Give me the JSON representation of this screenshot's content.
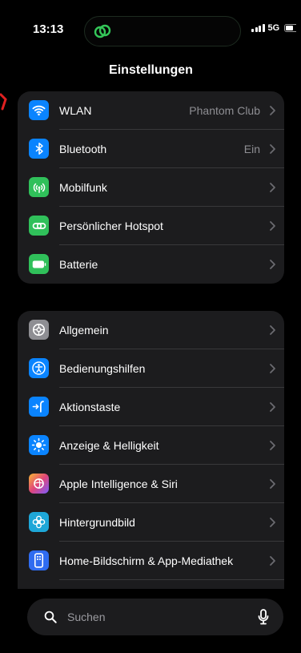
{
  "status_bar": {
    "time": "13:13",
    "network": "5G"
  },
  "page_title": "Einstellungen",
  "group1": [
    {
      "icon": "wifi-icon",
      "color": "#0a84ff",
      "label": "WLAN",
      "value": "Phantom Club"
    },
    {
      "icon": "bluetooth-icon",
      "color": "#0a84ff",
      "label": "Bluetooth",
      "value": "Ein"
    },
    {
      "icon": "antenna-icon",
      "color": "#30c05a",
      "label": "Mobilfunk",
      "value": ""
    },
    {
      "icon": "hotspot-link-icon",
      "color": "#30c05a",
      "label": "Persönlicher Hotspot",
      "value": ""
    },
    {
      "icon": "battery-icon",
      "color": "#30c05a",
      "label": "Batterie",
      "value": ""
    }
  ],
  "group2": [
    {
      "icon": "gear-icon",
      "color": "#8e8e93",
      "label": "Allgemein"
    },
    {
      "icon": "accessibility-icon",
      "color": "#0a84ff",
      "label": "Bedienungshilfen"
    },
    {
      "icon": "action-button-icon",
      "color": "#0a84ff",
      "label": "Aktionstaste"
    },
    {
      "icon": "sun-icon",
      "color": "#0a84ff",
      "label": "Anzeige & Helligkeit"
    },
    {
      "icon": "apple-intelligence-icon",
      "color": "#f5a623",
      "label": "Apple Intelligence & Siri"
    },
    {
      "icon": "flower-icon",
      "color": "#1ea7d8",
      "label": "Hintergrundbild"
    },
    {
      "icon": "home-screen-icon",
      "color": "#2f6cf0",
      "label": "Home-Bildschirm & App-Mediathek"
    }
  ],
  "search": {
    "placeholder": "Suchen"
  }
}
